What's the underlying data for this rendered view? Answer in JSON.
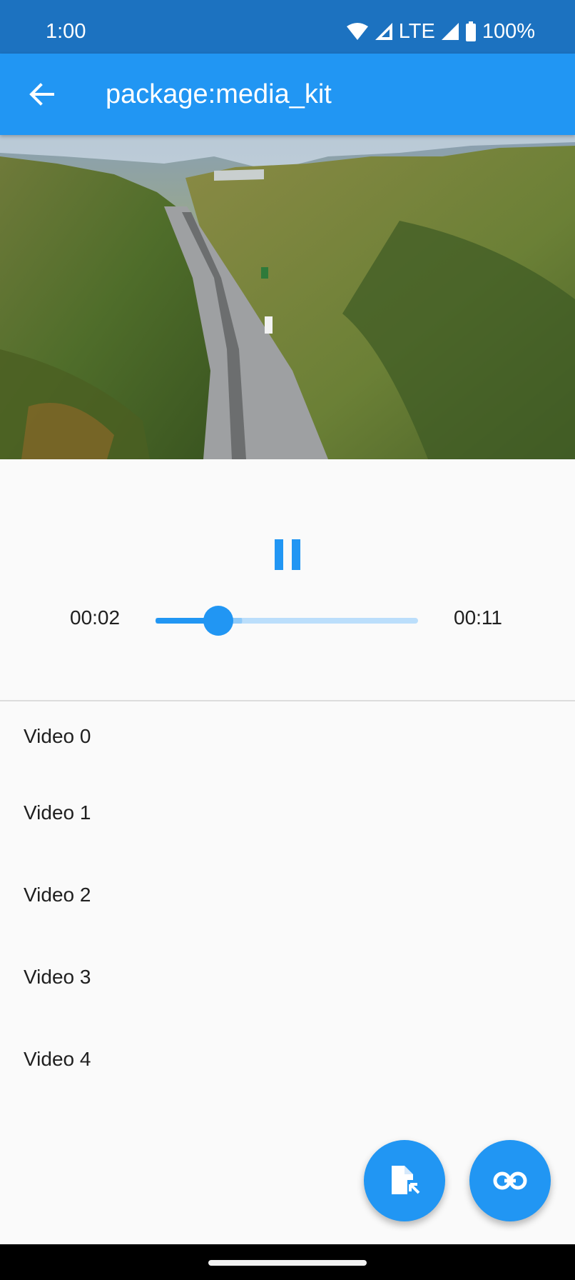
{
  "status_bar": {
    "time": "1:00",
    "network": "LTE",
    "battery": "100%",
    "icons": [
      "wifi-icon",
      "signal-icon",
      "battery-icon"
    ]
  },
  "app_bar": {
    "title": "package:media_kit",
    "back_icon": "arrow-back-icon"
  },
  "player": {
    "position": "00:02",
    "duration": "00:11",
    "progress": 0.24,
    "buffered": 0.33,
    "state_icon": "pause-icon"
  },
  "playlist": [
    {
      "label": "Video 0"
    },
    {
      "label": "Video 1"
    },
    {
      "label": "Video 2"
    },
    {
      "label": "Video 3"
    },
    {
      "label": "Video 4"
    }
  ],
  "fabs": [
    {
      "icon": "file-open-icon"
    },
    {
      "icon": "link-icon"
    }
  ],
  "colors": {
    "primary": "#2196f3",
    "status_bar": "#1c72c0",
    "background": "#fafafa"
  }
}
